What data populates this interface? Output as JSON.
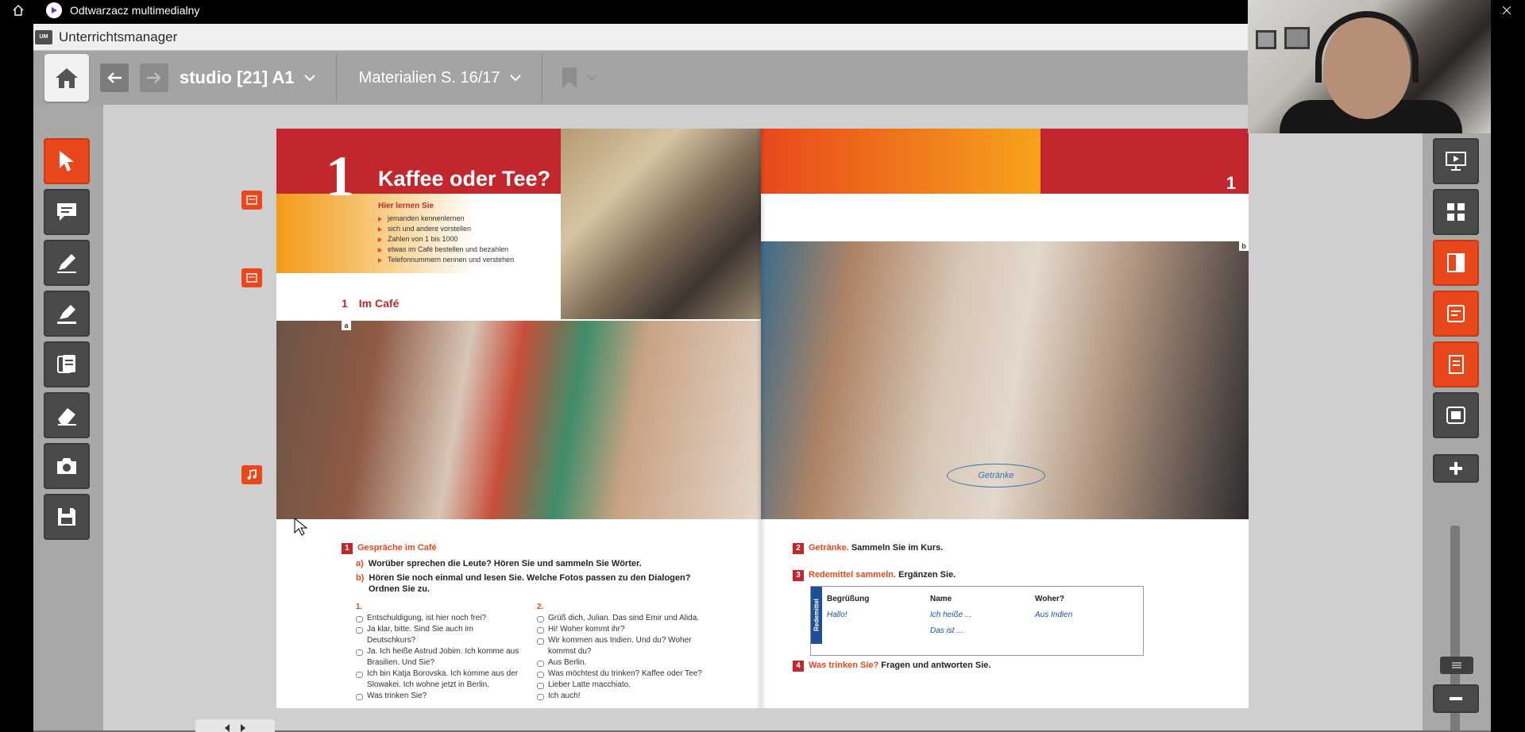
{
  "window": {
    "title": "Odtwarzacz multimedialny"
  },
  "app": {
    "title": "Unterrichtsmanager",
    "logo_text": "UM"
  },
  "navbar": {
    "book_title": "studio [21] A1",
    "pages_label": "Materialien S. 16/17"
  },
  "book": {
    "chapter_number": "1",
    "chapter_title": "Kaffee oder Tee?",
    "learn_heading": "Hier lernen Sie",
    "learn_items": [
      "jemanden kennenlernen",
      "sich und andere vorstellen",
      "Zahlen von 1 bis 1000",
      "etwas im Café bestellen und bezahlen",
      "Telefonnummern nennen und verstehen"
    ],
    "section_number": "1",
    "section_title": "Im Café",
    "photo_label_a": "a",
    "photo_label_b": "b",
    "right_chapter_number": "1",
    "ex1": {
      "number": "1",
      "title": "Gespräche im Café",
      "a_label": "a)",
      "a_text": "Worüber sprechen die Leute? Hören Sie und sammeln Sie Wörter.",
      "b_label": "b)",
      "b_text": "Hören Sie noch einmal und lesen Sie. Welche Fotos passen zu den Dialogen?",
      "b_text2": "Ordnen Sie zu.",
      "dialog1_head": "1.",
      "dialog1": [
        "Entschuldigung, ist hier noch frei?",
        "Ja klar, bitte. Sind Sie auch im Deutschkurs?",
        "Ja. Ich heiße Astrud Jobim. Ich komme aus Brasilien. Und Sie?",
        "Ich bin Katja Borovska. Ich komme aus der Slowakei. Ich wohne jetzt in Berlin.",
        "Was trinken Sie?"
      ],
      "dialog2_head": "2.",
      "dialog2": [
        "Grüß dich, Julian. Das sind Emir und Alida.",
        "Hi! Woher kommt ihr?",
        "Wir kommen aus Indien. Und du? Woher kommst du?",
        "Aus Berlin.",
        "Was möchtest du trinken? Kaffee oder Tee?",
        "Lieber Latte macchiato.",
        "Ich auch!"
      ]
    },
    "ex2": {
      "number": "2",
      "title": "Getränke.",
      "text": "Sammeln Sie im Kurs.",
      "oval": "Getränke"
    },
    "ex3": {
      "number": "3",
      "title": "Redemittel sammeln.",
      "text": "Ergänzen Sie.",
      "bar": "Redemittel",
      "col1": "Begrüßung",
      "col2": "Name",
      "col3": "Woher?",
      "hand1": "Hallo!",
      "hand2": "Ich heiße ...",
      "hand3": "Aus Indien",
      "hand4": "Das ist ..."
    },
    "ex4": {
      "number": "4",
      "title": "Was trinken Sie?",
      "text": "Fragen und antworten Sie."
    }
  },
  "colors": {
    "accent": "#e8481b",
    "book_red": "#c1272d",
    "toolbar_dark": "#4a4a4a"
  },
  "icons": {
    "left_tools": [
      "pointer-icon",
      "comment-icon",
      "pen-icon",
      "highlighter-icon",
      "pages-icon",
      "eraser-icon",
      "camera-icon",
      "save-icon"
    ],
    "right_tools": [
      "presentation-icon",
      "grid-icon",
      "panel-icon",
      "note-icon",
      "worksheet-icon",
      "fullscreen-icon",
      "zoom-in-icon",
      "zoom-out-icon"
    ]
  }
}
